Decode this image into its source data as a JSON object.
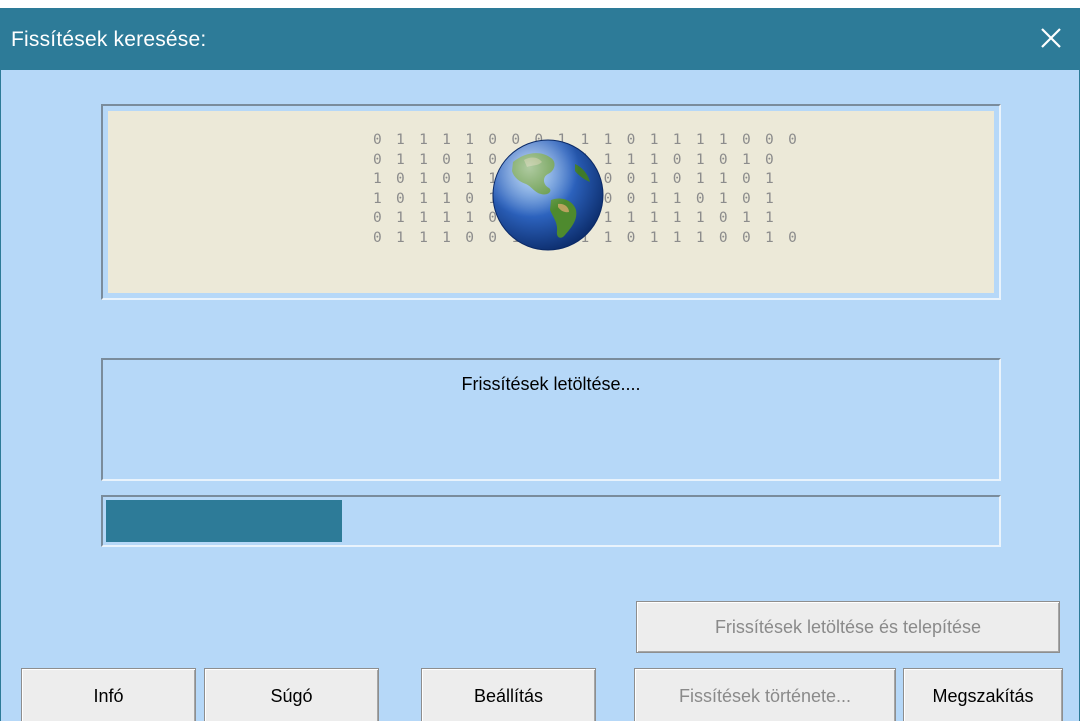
{
  "window": {
    "title": "Fissítések keresése:"
  },
  "icons": {
    "close": "close-icon",
    "globe": "globe-icon"
  },
  "banner": {
    "binary_lines": [
      "0 1 1 1 1 0 0 0 1 1 1 0 1 1 1 1 0 0 0",
      "0 1 1 0 1 0 1 0 1 1 1 1 1 0 1 0 1 0",
      "1 0 1 0 1 1 0 0 0 1 0 0 1 0 1 1 0 1",
      "1 0 1 1 0 1 0 1 1 0 0 0 1 1 0 1 0 1",
      "0 1 1 1 1 0 1 0 1 0 1 1 1 1 1 0 1 1",
      "0 1 1 1 0 0 1 0 0 1 1 0 1 1 1 0 0 1 0"
    ]
  },
  "status": {
    "text": "Frissítések letöltése...."
  },
  "progress": {
    "fraction": 0.265
  },
  "buttons": {
    "download_install": "Frissítések letöltése és telepítése",
    "info": "Infó",
    "help": "Súgó",
    "settings": "Beállítás",
    "history": "Fissítések története...",
    "cancel": "Megszakítás"
  },
  "colors": {
    "titlebar": "#2d7b98",
    "background": "#b6d8f8",
    "banner": "#ece9d8",
    "progress": "#2d7b98"
  }
}
